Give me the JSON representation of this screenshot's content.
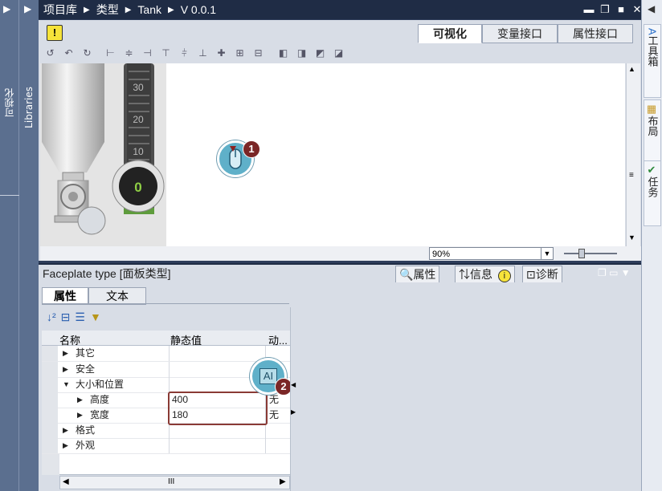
{
  "left_panel": {
    "visualization_label": "可视化",
    "libraries_label": "Libraries"
  },
  "breadcrumb": {
    "items": [
      "项目库",
      "类型",
      "Tank",
      "V 0.0.1"
    ]
  },
  "right_panel": {
    "tabs": [
      "工具箱",
      "布局",
      "任务"
    ]
  },
  "editor": {
    "tabs": [
      "可视化",
      "变量接口",
      "属性接口"
    ],
    "active_tab": "可视化",
    "zoom": "90%",
    "gauge": {
      "ticks": [
        "30",
        "20",
        "10"
      ],
      "value": "0"
    }
  },
  "callouts": {
    "first": "1",
    "second": "2",
    "ai_label": "AI"
  },
  "inspector": {
    "title": "Faceplate type [面板类型]",
    "tabs": [
      "属性",
      "信息",
      "诊断"
    ],
    "subtabs": [
      "属性",
      "文本"
    ],
    "grid": {
      "headers": [
        "名称",
        "静态值",
        "动..."
      ],
      "rows": [
        {
          "name": "其它",
          "value": "",
          "extra": ""
        },
        {
          "name": "安全",
          "value": "",
          "extra": ""
        },
        {
          "name": "大小和位置",
          "value": "",
          "extra": ""
        },
        {
          "name": "高度",
          "value": "400",
          "extra": "无"
        },
        {
          "name": "宽度",
          "value": "180",
          "extra": "无"
        },
        {
          "name": "格式",
          "value": "",
          "extra": ""
        },
        {
          "name": "外观",
          "value": "",
          "extra": ""
        }
      ]
    },
    "hscroll_label": "III"
  }
}
